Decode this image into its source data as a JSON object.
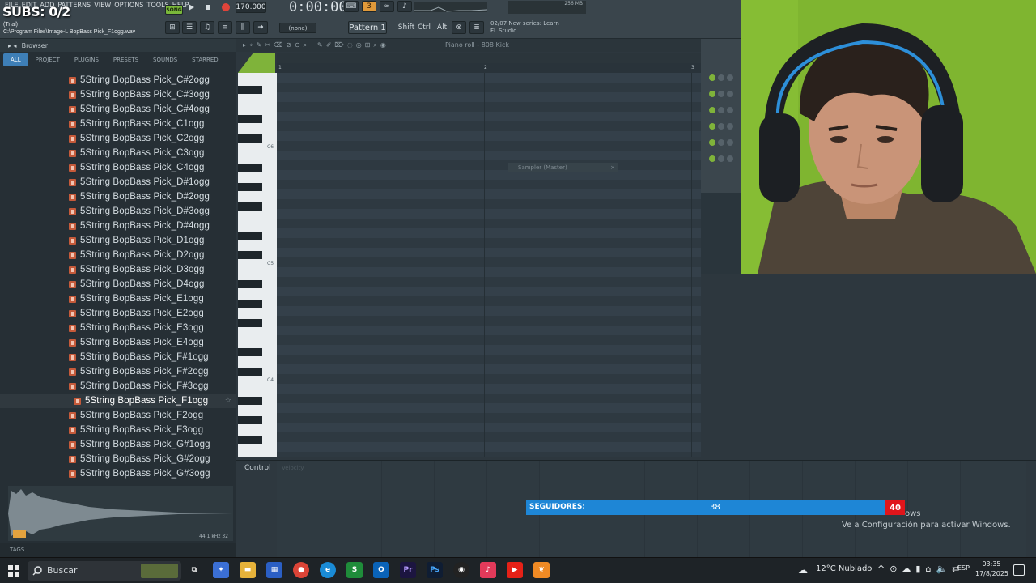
{
  "overlay": {
    "subs": "SUBS: 0/2"
  },
  "menu": [
    "FILE",
    "EDIT",
    "ADD",
    "PATTERNS",
    "VIEW",
    "OPTIONS",
    "TOOLS",
    "HELP"
  ],
  "project": {
    "trial": "(Trial)",
    "path": "C:\\Program Files\\Image-L BopBass Pick_F1ogg.wav"
  },
  "transport": {
    "mode": "SONG",
    "tempo": "170.000",
    "time": "0:00:00"
  },
  "toolbar": {
    "pattern_none": "(none)",
    "pattern": "Pattern 1",
    "keys": [
      "Shift",
      "Ctrl",
      "Alt"
    ],
    "hint_line1": "02/07  New series: Learn",
    "hint_line2": "FL Studio",
    "memory": "256 MB"
  },
  "browser": {
    "title": "Browser",
    "tabs": [
      "ALL",
      "PROJECT",
      "PLUGINS",
      "PRESETS",
      "SOUNDS",
      "STARRED"
    ],
    "files": [
      "5String BopBass Pick_C#2ogg",
      "5String BopBass Pick_C#3ogg",
      "5String BopBass Pick_C#4ogg",
      "5String BopBass Pick_C1ogg",
      "5String BopBass Pick_C2ogg",
      "5String BopBass Pick_C3ogg",
      "5String BopBass Pick_C4ogg",
      "5String BopBass Pick_D#1ogg",
      "5String BopBass Pick_D#2ogg",
      "5String BopBass Pick_D#3ogg",
      "5String BopBass Pick_D#4ogg",
      "5String BopBass Pick_D1ogg",
      "5String BopBass Pick_D2ogg",
      "5String BopBass Pick_D3ogg",
      "5String BopBass Pick_D4ogg",
      "5String BopBass Pick_E1ogg",
      "5String BopBass Pick_E2ogg",
      "5String BopBass Pick_E3ogg",
      "5String BopBass Pick_E4ogg",
      "5String BopBass Pick_F#1ogg",
      "5String BopBass Pick_F#2ogg",
      "5String BopBass Pick_F#3ogg",
      "5String BopBass Pick_F1ogg",
      "5String BopBass Pick_F2ogg",
      "5String BopBass Pick_F3ogg",
      "5String BopBass Pick_G#1ogg",
      "5String BopBass Pick_G#2ogg",
      "5String BopBass Pick_G#3ogg"
    ],
    "selected_index": 22,
    "waveform_info": "44.1 kHz 32",
    "tags_label": "TAGS"
  },
  "piano_roll": {
    "title": "Piano roll - 808 Kick",
    "bars": [
      "1",
      "2",
      "3"
    ],
    "octave_labels": [
      "C6",
      "C5",
      "C4"
    ],
    "sampler_title": "Sampler (Master)"
  },
  "control": {
    "label": "Control",
    "sub": "Velocity"
  },
  "followers": {
    "label": "SEGUIDORES:",
    "count": "38",
    "goal": "40",
    "progress": 0.95
  },
  "windows_watermark": {
    "line1": "ows",
    "line2": "Ve a Configuración para activar Windows."
  },
  "taskbar": {
    "search_placeholder": "Buscar",
    "weather": "12°C  Nublado",
    "language": "ESP",
    "time": "03:35",
    "date": "17/8/2025"
  },
  "colors": {
    "accent": "#3e7fb7",
    "song": "#7ab83a",
    "followers_bar": "#1e86d6",
    "goal": "#e0151b"
  }
}
